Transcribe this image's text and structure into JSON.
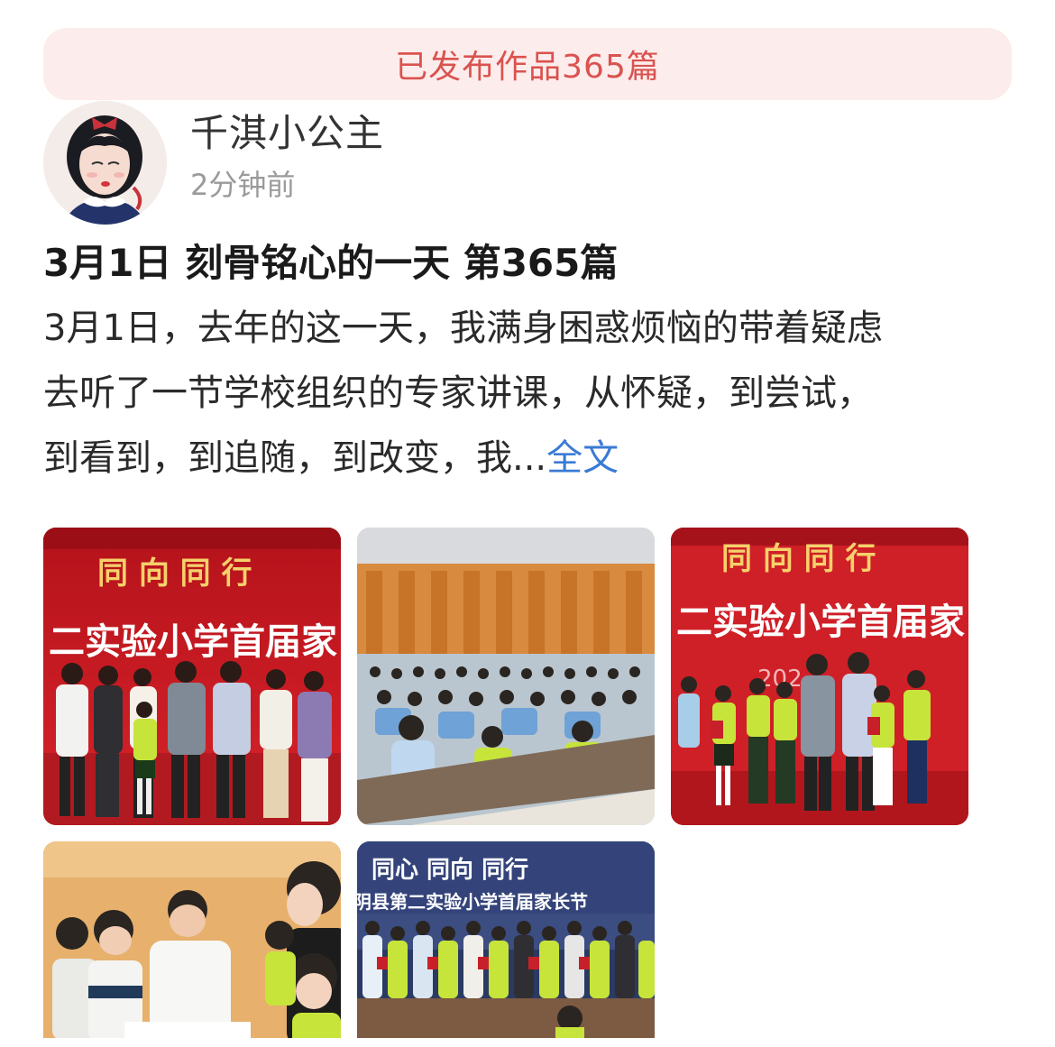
{
  "banner": {
    "text": "已发布作品365篇"
  },
  "author": {
    "name": "千淇小公主",
    "time": "2分钟前"
  },
  "post": {
    "title": "3月1日 刻骨铭心的一天 第365篇",
    "body_lines": [
      "3月1日，去年的这一天，我满身困惑烦恼的带着疑虑",
      "去听了一节学校组织的专家讲课，从怀疑，到尝试，",
      "到看到，到追随，到改变，我..."
    ],
    "more_label": "全文"
  },
  "photos": {
    "p1": {
      "line1": "同 向  同 行",
      "line2": "二实验小学首届家"
    },
    "p3": {
      "line1": "同 向  同 行",
      "line2": "二实验小学首届家",
      "line3": "202"
    },
    "p5": {
      "line1": "同心 同向 同行",
      "line2": "阴县第二实验小学首届家长节"
    }
  },
  "colors": {
    "banner_bg": "#fdecec",
    "banner_text": "#d9534f",
    "link": "#3a7bd5",
    "timestamp": "#9a9a9a"
  }
}
